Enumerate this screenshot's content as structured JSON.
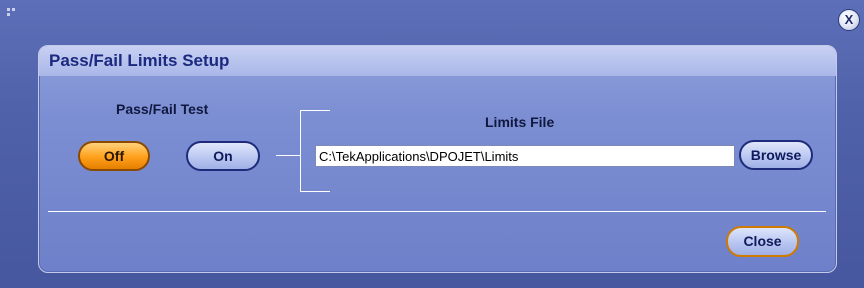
{
  "window": {
    "close_glyph": "X"
  },
  "panel": {
    "title": "Pass/Fail Limits Setup",
    "pass_fail_test": {
      "label": "Pass/Fail Test",
      "off_label": "Off",
      "on_label": "On",
      "selected": "Off"
    },
    "limits_file": {
      "label": "Limits File",
      "path_value": "C:\\TekApplications\\DPOJET\\Limits",
      "browse_label": "Browse"
    },
    "close_label": "Close"
  },
  "colors": {
    "background": "#4f61a8",
    "panel": "#7d8fd3",
    "title_text": "#1b2a80",
    "selected_button": "#ff9f1a",
    "button": "#b8c5f0"
  },
  "icons": {
    "corner": "resize-grip-icon",
    "window_close": "close-icon"
  }
}
